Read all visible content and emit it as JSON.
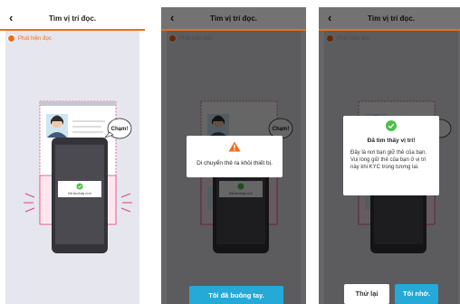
{
  "header": {
    "back_glyph": "‹",
    "title": "Tìm vị trí đọc."
  },
  "badge": {
    "label": "Phát hiện đọc"
  },
  "illustration": {
    "speech": "Chạm!",
    "phone_status": "Đã tìm thấy vị trí"
  },
  "panel2": {
    "dialog_message": "Di chuyển thẻ ra khỏi thiết bị.",
    "phone_status": "Đã tìm thấy vị trí",
    "button_label": "Tôi đã buông tay."
  },
  "panel3": {
    "dialog_title": "Đã tìm thấy vị trí!",
    "dialog_line1": "Đây là nơi bạn giữ thẻ của bạn.",
    "dialog_line2": "Vui lòng giữ thẻ của bạn ở vị trí này khi KYC trong tương lai.",
    "retry_label": "Thử lại",
    "remember_label": "Tôi nhớ."
  },
  "colors": {
    "accent": "#ef6c1a",
    "button": "#25a9d6",
    "success": "#4cc04a",
    "warning": "#ef6c1a"
  },
  "icons": {
    "back": "chevron-left-icon",
    "indicator": "orange-dot",
    "success": "check-circle-icon",
    "warning": "warning-triangle-icon"
  }
}
